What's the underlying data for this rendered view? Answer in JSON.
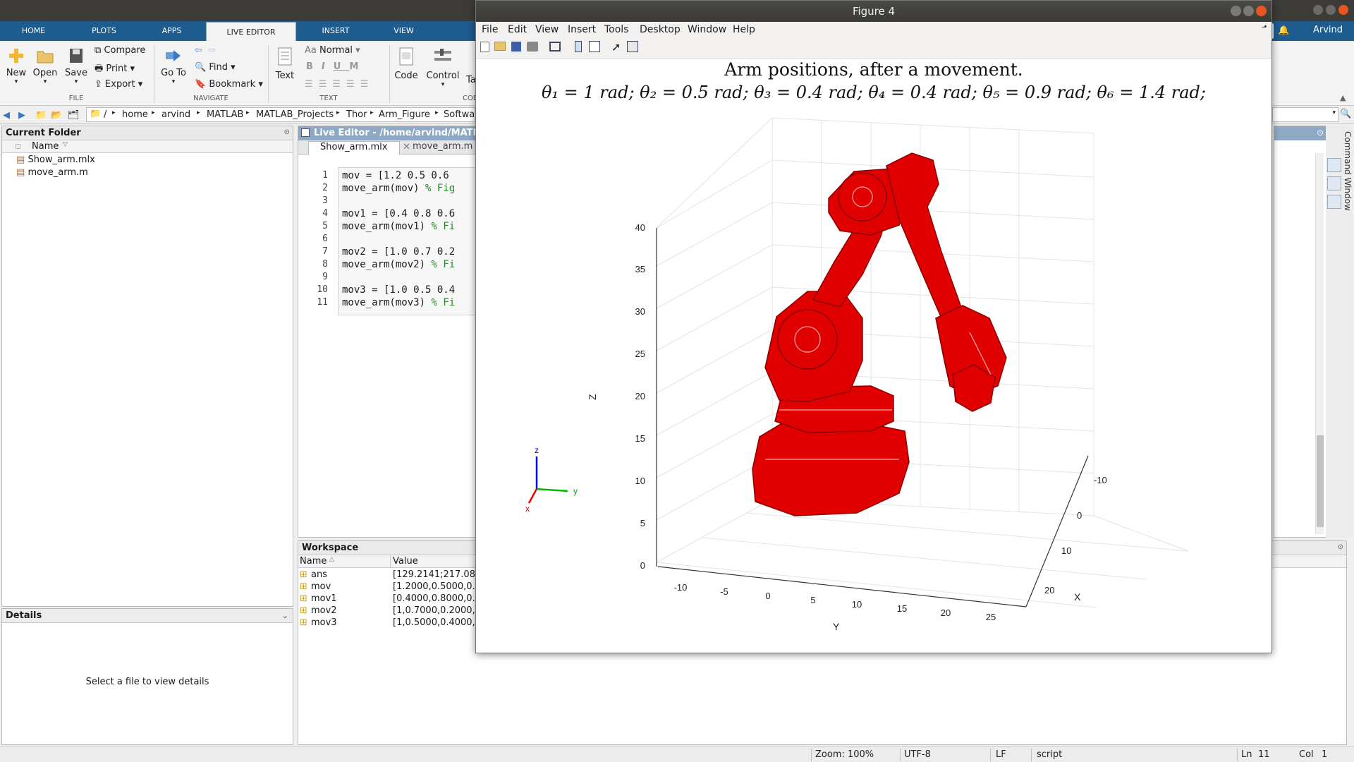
{
  "ribbon_tabs": [
    "HOME",
    "PLOTS",
    "APPS",
    "LIVE EDITOR",
    "INSERT",
    "VIEW"
  ],
  "file_group": {
    "new": "New",
    "open": "Open",
    "save": "Save",
    "compare": "Compare",
    "print": "Print",
    "export": "Export",
    "label": "FILE"
  },
  "navigate_group": {
    "goto": "Go To",
    "find": "Find",
    "bookmark": "Bookmark",
    "label": "NAVIGATE"
  },
  "text_group": {
    "style": "Normal",
    "text": "Text",
    "label": "TEXT",
    "bold": "B",
    "italic": "I",
    "underline": "U",
    "mono": "M"
  },
  "code_group": {
    "code": "Code",
    "control": "Control",
    "task": "Ta",
    "label": "COD"
  },
  "user_name": "Arvind",
  "address": [
    "/",
    "home",
    "arvind",
    "MATLAB",
    "MATLAB_Projects",
    "Thor",
    "Arm_Figure",
    "Softwar"
  ],
  "current_folder": {
    "title": "Current Folder",
    "column": "Name",
    "files": [
      "Show_arm.mlx",
      "move_arm.m"
    ]
  },
  "details": {
    "title": "Details",
    "message": "Select a file to view details"
  },
  "editor": {
    "title": "Live Editor - /home/arvind/MATLA",
    "tabs": [
      "Show_arm.mlx",
      "move_arm.m"
    ],
    "lines": [
      {
        "n": "1",
        "code": "mov = [1.2 0.5 0.6",
        "comment": ""
      },
      {
        "n": "2",
        "code": "move_arm(mov) ",
        "comment": "% Fig"
      },
      {
        "n": "3",
        "code": "",
        "comment": ""
      },
      {
        "n": "4",
        "code": "mov1 = [0.4 0.8 0.6",
        "comment": ""
      },
      {
        "n": "5",
        "code": "move_arm(mov1) ",
        "comment": "% Fi"
      },
      {
        "n": "6",
        "code": "",
        "comment": ""
      },
      {
        "n": "7",
        "code": "mov2 = [1.0 0.7 0.2",
        "comment": ""
      },
      {
        "n": "8",
        "code": "move_arm(mov2) ",
        "comment": "% Fi"
      },
      {
        "n": "9",
        "code": "",
        "comment": ""
      },
      {
        "n": "10",
        "code": "mov3 = [1.0 0.5 0.4",
        "comment": ""
      },
      {
        "n": "11",
        "code": "move_arm(mov3) ",
        "comment": "% Fi"
      }
    ]
  },
  "workspace": {
    "title": "Workspace",
    "col_name": "Name",
    "col_value": "Value",
    "vars": [
      {
        "name": "ans",
        "value": "[129.2141;217.083"
      },
      {
        "name": "mov",
        "value": "[1.2000,0.5000,0.6"
      },
      {
        "name": "mov1",
        "value": "[0.4000,0.8000,0.6"
      },
      {
        "name": "mov2",
        "value": "[1,0.7000,0.2000,0"
      },
      {
        "name": "mov3",
        "value": "[1,0.5000,0.4000,0"
      }
    ]
  },
  "command_window_label": "Command Window",
  "status": {
    "zoom": "Zoom: 100%",
    "encoding": "UTF-8",
    "eol": "LF",
    "type": "script",
    "ln_label": "Ln",
    "ln": "11",
    "col_label": "Col",
    "col": "1"
  },
  "figure": {
    "title": "Figure 4",
    "menu": [
      "File",
      "Edit",
      "View",
      "Insert",
      "Tools",
      "Desktop",
      "Window",
      "Help"
    ],
    "plot_title_line1": "Arm positions, after a movement.",
    "plot_title_line2": "θ₁ = 1 rad; θ₂ = 0.5 rad; θ₃ = 0.4 rad; θ₄ = 0.4 rad; θ₅ = 0.9 rad; θ₆ = 1.4 rad;",
    "axis_labels": {
      "x": "X",
      "y": "Y",
      "z": "Z"
    },
    "triad_labels": {
      "x": "x",
      "y": "y",
      "z": "z"
    },
    "arm_color": "#e00000"
  },
  "chart_data": {
    "type": "other",
    "title": "Arm positions, after a movement.",
    "subtitle": "θ₁ = 1 rad; θ₂ = 0.5 rad; θ₃ = 0.4 rad; θ₄ = 0.4 rad; θ₅ = 0.9 rad; θ₆ = 1.4 rad;",
    "xlabel": "X",
    "ylabel": "Y",
    "zlabel": "Z",
    "x_ticks": [
      "-10",
      "0",
      "10",
      "20"
    ],
    "y_ticks": [
      "-10",
      "-5",
      "0",
      "5",
      "10",
      "15",
      "20",
      "25"
    ],
    "z_ticks": [
      "0",
      "5",
      "10",
      "15",
      "20",
      "25",
      "30",
      "35",
      "40"
    ],
    "grid": true
  }
}
